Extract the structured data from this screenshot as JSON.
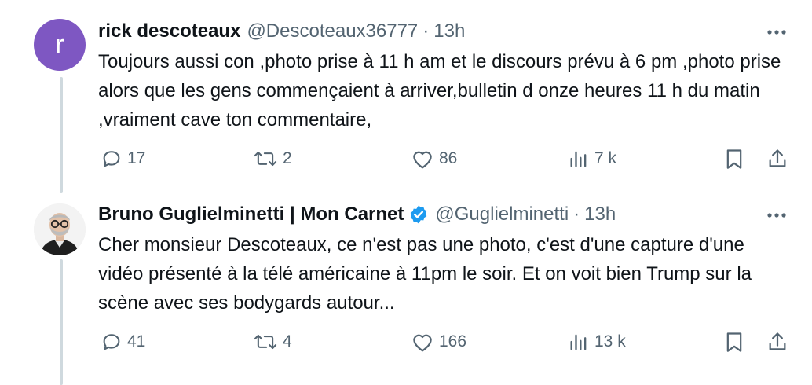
{
  "tweets": [
    {
      "avatar_letter": "r",
      "name": "rick descoteaux",
      "handle": "@Descoteaux36777",
      "separator": "·",
      "time": "13h",
      "text": "Toujours aussi con ,photo prise à 11 h am et le discours prévu à 6 pm ,photo prise alors que les gens commençaient à arriver,bulletin d onze heures 11 h du matin ,vraiment cave ton commentaire,",
      "replies": "17",
      "reposts": "2",
      "likes": "86",
      "views": "7 k"
    },
    {
      "name": "Bruno Guglielminetti | Mon Carnet",
      "verified": true,
      "handle": "@Guglielminetti",
      "separator": "·",
      "time": "13h",
      "text": "Cher monsieur Descoteaux, ce n'est pas une photo, c'est d'une capture d'une vidéo présenté à la télé américaine à 11pm le soir. Et on voit bien Trump sur la scène avec ses bodygards autour...",
      "replies": "41",
      "reposts": "4",
      "likes": "166",
      "views": "13 k"
    }
  ],
  "colors": {
    "accent_verified": "#1d9bf0",
    "avatar_bg": "#7e57c2",
    "secondary_text": "#536471",
    "thread_line": "#cfd9de"
  },
  "icons": [
    "reply-icon",
    "repost-icon",
    "like-icon",
    "views-icon",
    "bookmark-icon",
    "share-icon",
    "more-icon",
    "verified-badge-icon"
  ]
}
